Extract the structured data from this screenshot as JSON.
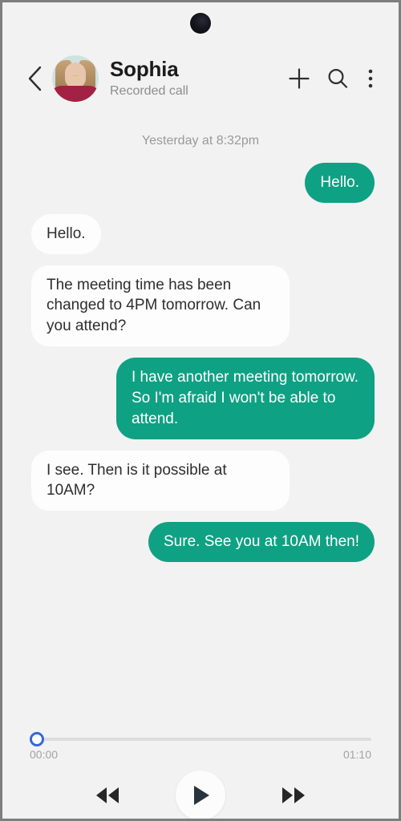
{
  "status_bar": {
    "camera_icon": "punch-hole-camera"
  },
  "header": {
    "back_icon": "chevron-left-icon",
    "avatar_icon": "contact-avatar",
    "contact_name": "Sophia",
    "subtitle": "Recorded call",
    "actions": [
      {
        "icon": "plus-icon",
        "label": "Add"
      },
      {
        "icon": "search-icon",
        "label": "Search"
      },
      {
        "icon": "more-vertical-icon",
        "label": "More options"
      }
    ]
  },
  "conversation": {
    "date_divider": "Yesterday at 8:32pm",
    "messages": [
      {
        "direction": "out",
        "text": "Hello.",
        "short": true
      },
      {
        "direction": "in",
        "text": "Hello.",
        "short": true
      },
      {
        "direction": "in",
        "text": "The meeting time has been changed to 4PM tomorrow. Can you attend?",
        "short": false
      },
      {
        "direction": "out",
        "text": "I have another meeting tomorrow. So I'm afraid I won't be able to attend.",
        "short": false
      },
      {
        "direction": "in",
        "text": "I see. Then is it possible at 10AM?",
        "short": false
      },
      {
        "direction": "out",
        "text": "Sure. See you at 10AM then!",
        "short": true
      }
    ]
  },
  "player": {
    "current_time": "00:00",
    "total_time": "01:10",
    "progress_percent": 0,
    "thumb_icon": "seek-thumb",
    "controls": [
      {
        "icon": "rewind-icon",
        "label": "Rewind"
      },
      {
        "icon": "play-icon",
        "label": "Play"
      },
      {
        "icon": "fast-forward-icon",
        "label": "Fast forward"
      }
    ]
  },
  "colors": {
    "background": "#f2f2f2",
    "outgoing_bubble": "#0fa183",
    "incoming_bubble": "#fdfdfd",
    "accent_seek": "#3568d4",
    "play_glyph": "#27333d"
  }
}
